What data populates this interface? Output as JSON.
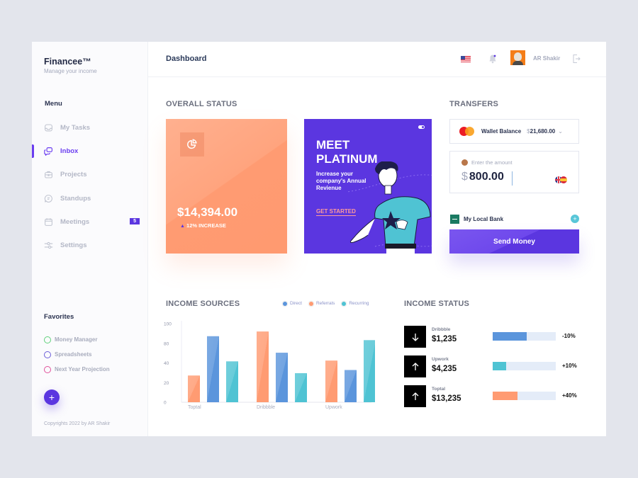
{
  "brand": {
    "name": "Financee™",
    "tagline": "Manage your income"
  },
  "sidebar": {
    "menu_title": "Menu",
    "items": [
      {
        "label": "My Tasks",
        "icon": "inbox-tray-icon",
        "active": false
      },
      {
        "label": "Inbox",
        "icon": "chat-bubbles-icon",
        "active": true
      },
      {
        "label": "Projects",
        "icon": "briefcase-icon",
        "active": false
      },
      {
        "label": "Standups",
        "icon": "chat-icon",
        "active": false
      },
      {
        "label": "Meetings",
        "icon": "calendar-icon",
        "active": false,
        "badge": "5"
      },
      {
        "label": "Settings",
        "icon": "sliders-icon",
        "active": false
      }
    ],
    "favorites_title": "Favorites",
    "favorites": [
      {
        "label": "Money Manager",
        "color": "#5fd07a"
      },
      {
        "label": "Spreadsheets",
        "color": "#6a5cd8"
      },
      {
        "label": "Next Year Projection",
        "color": "#e0509a"
      }
    ],
    "add_label": "+",
    "copyright": "Copyrights 2022 by AR Shakir"
  },
  "header": {
    "title": "Dashboard",
    "user_name": "AR Shakir",
    "language_flag": "us-flag-icon"
  },
  "overall_status": {
    "title": "OVERALL STATUS",
    "amount": "$14,394.00",
    "change_icon": "▲",
    "change_text": "12% INCREASE",
    "color": "#ff9b72"
  },
  "promo": {
    "title": "MEET PLATINUM",
    "description": "Increase your company's Annual Revienue",
    "cta": "GET STARTED",
    "color": "#5b36e0"
  },
  "transfers": {
    "title": "TRANSFERS",
    "wallet_label": "Wallet Balance",
    "wallet_currency": "$",
    "wallet_amount": "21,680.00",
    "amount_placeholder": "Enter the amount",
    "amount_currency": "$",
    "amount_value": "800.00",
    "bank_label": "My Local Bank",
    "send_button": "Send Money"
  },
  "income_sources": {
    "title": "INCOME SOURCES"
  },
  "chart_data": {
    "type": "bar",
    "title": "INCOME SOURCES",
    "categories": [
      "Toptal",
      "Dribbble",
      "Upwork"
    ],
    "series": [
      {
        "name": "Referrals",
        "color": "#ff9b72",
        "values": [
          34,
          90,
          53
        ]
      },
      {
        "name": "Direct",
        "color": "#5b95dc",
        "values": [
          84,
          63,
          41
        ]
      },
      {
        "name": "Recurring",
        "color": "#4fc3d3",
        "values": [
          52,
          37,
          79
        ]
      }
    ],
    "legend": [
      {
        "name": "Direct",
        "color": "#5b95dc"
      },
      {
        "name": "Referrals",
        "color": "#ff9b72"
      },
      {
        "name": "Recurring",
        "color": "#4fc3d3"
      }
    ],
    "legend_position": "top-right",
    "ytick_labels": [
      "0",
      "20",
      "40",
      "80",
      "100"
    ],
    "ylim": [
      0,
      100
    ],
    "xlabel": "",
    "ylabel": "",
    "grid": false
  },
  "income_status": {
    "title": "INCOME STATUS",
    "rows": [
      {
        "name": "Dribbble",
        "amount": "$1,235",
        "direction": "down",
        "progress": 0.54,
        "color": "#5b95dc",
        "change": "-10%"
      },
      {
        "name": "Upwork",
        "amount": "$4,235",
        "direction": "up",
        "progress": 0.21,
        "color": "#4fc3d3",
        "change": "+10%"
      },
      {
        "name": "Toptal",
        "amount": "$13,235",
        "direction": "up",
        "progress": 0.39,
        "color": "#ff9b72",
        "change": "+40%"
      }
    ]
  }
}
